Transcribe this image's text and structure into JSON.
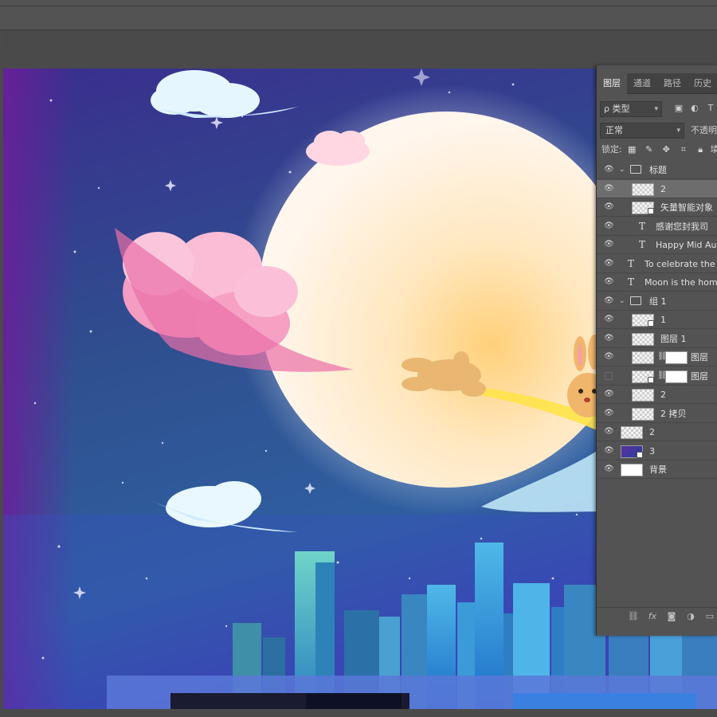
{
  "panel": {
    "tabs": [
      "图层",
      "通道",
      "路径",
      "历史"
    ],
    "filter_kind": "ρ 类型",
    "blend_mode": "正常",
    "opacity_label": "不透明",
    "lock_label": "锁定:",
    "fill_label": "填"
  },
  "layers": [
    {
      "name": "标题",
      "kind": "group",
      "visible": true,
      "expanded": true,
      "indent": 0
    },
    {
      "name": "2",
      "kind": "pixel",
      "visible": true,
      "indent": 1,
      "selected": true
    },
    {
      "name": "矢量智能对象",
      "kind": "smart",
      "visible": true,
      "indent": 1
    },
    {
      "name": "感谢您封我司",
      "kind": "text",
      "visible": true,
      "indent": 1
    },
    {
      "name": "Happy Mid Au",
      "kind": "text",
      "visible": true,
      "indent": 1
    },
    {
      "name": "To celebrate the",
      "kind": "text",
      "visible": true,
      "indent": 0
    },
    {
      "name": "Moon is the hom",
      "kind": "text",
      "visible": true,
      "indent": 0
    },
    {
      "name": "组 1",
      "kind": "group",
      "visible": true,
      "expanded": true,
      "indent": 0
    },
    {
      "name": "1",
      "kind": "smart",
      "visible": true,
      "indent": 1
    },
    {
      "name": "图层 1",
      "kind": "pixel",
      "visible": true,
      "indent": 1
    },
    {
      "name": "图层",
      "kind": "masked",
      "visible": true,
      "indent": 1
    },
    {
      "name": "图层",
      "kind": "masked-smart",
      "visible": false,
      "indent": 1
    },
    {
      "name": "2",
      "kind": "pixel",
      "visible": true,
      "indent": 1
    },
    {
      "name": "2 拷贝",
      "kind": "pixel",
      "visible": true,
      "indent": 1
    },
    {
      "name": "2",
      "kind": "pixel",
      "visible": true,
      "indent": 0
    },
    {
      "name": "3",
      "kind": "smart-purple",
      "visible": true,
      "indent": 0
    },
    {
      "name": "背景",
      "kind": "background",
      "visible": true,
      "indent": 0
    }
  ],
  "panel_bottom_icons": [
    "link-icon",
    "fx-icon",
    "mask-icon",
    "adjustment-icon",
    "folder-icon"
  ],
  "colors": {
    "sky_top": "#2a2f8a",
    "sky_bottom": "#3a7fc0",
    "moon": "#fff3d6",
    "cloud_pink": "#f7a6c8"
  }
}
